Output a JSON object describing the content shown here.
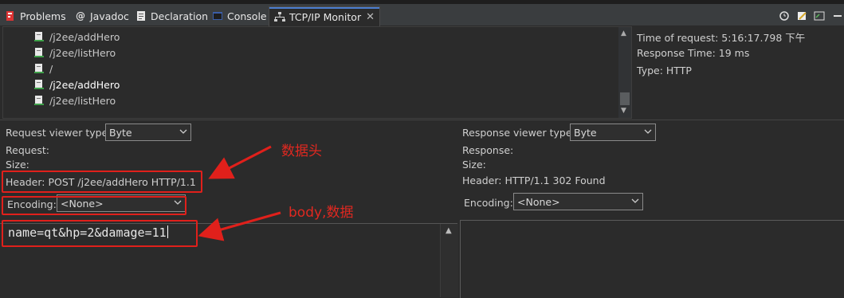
{
  "tabs": [
    {
      "label": "Problems",
      "icon": "problems-icon",
      "active": false
    },
    {
      "label": "Javadoc",
      "icon": "javadoc-icon",
      "active": false
    },
    {
      "label": "Declaration",
      "icon": "declaration-icon",
      "active": false
    },
    {
      "label": "Console",
      "icon": "console-icon",
      "active": false
    },
    {
      "label": "TCP/IP Monitor",
      "icon": "tcpip-monitor-icon",
      "active": true
    }
  ],
  "requests": [
    {
      "path": "/j2ee/addHero",
      "selected": false
    },
    {
      "path": "/j2ee/listHero",
      "selected": false
    },
    {
      "path": "/",
      "selected": false
    },
    {
      "path": "/j2ee/addHero",
      "selected": true
    },
    {
      "path": "/j2ee/listHero",
      "selected": false
    }
  ],
  "info": {
    "time_of_request": "Time of request: 5:16:17.798 下午",
    "response_time": "Response Time: 19 ms",
    "type": "Type: HTTP"
  },
  "request": {
    "viewer_label": "Request viewer type:",
    "viewer_value": "Byte",
    "request_label": "Request:",
    "size_label": "Size:",
    "header": "Header: POST /j2ee/addHero HTTP/1.1",
    "encoding_label": "Encoding:",
    "encoding_value": "<None>",
    "body": "name=qt&hp=2&damage=11"
  },
  "response": {
    "viewer_label": "Response viewer type:",
    "viewer_value": "Byte",
    "response_label": "Response:",
    "size_label": "Size:",
    "header": "Header: HTTP/1.1 302 Found",
    "encoding_label": "Encoding:",
    "encoding_value": "<None>"
  },
  "annotations": {
    "header_note": "数据头",
    "body_note": "body,数据"
  },
  "colors": {
    "background": "#2b2b2b",
    "annotation_red": "#e0201b",
    "active_tab_accent": "#4b7ed0"
  }
}
